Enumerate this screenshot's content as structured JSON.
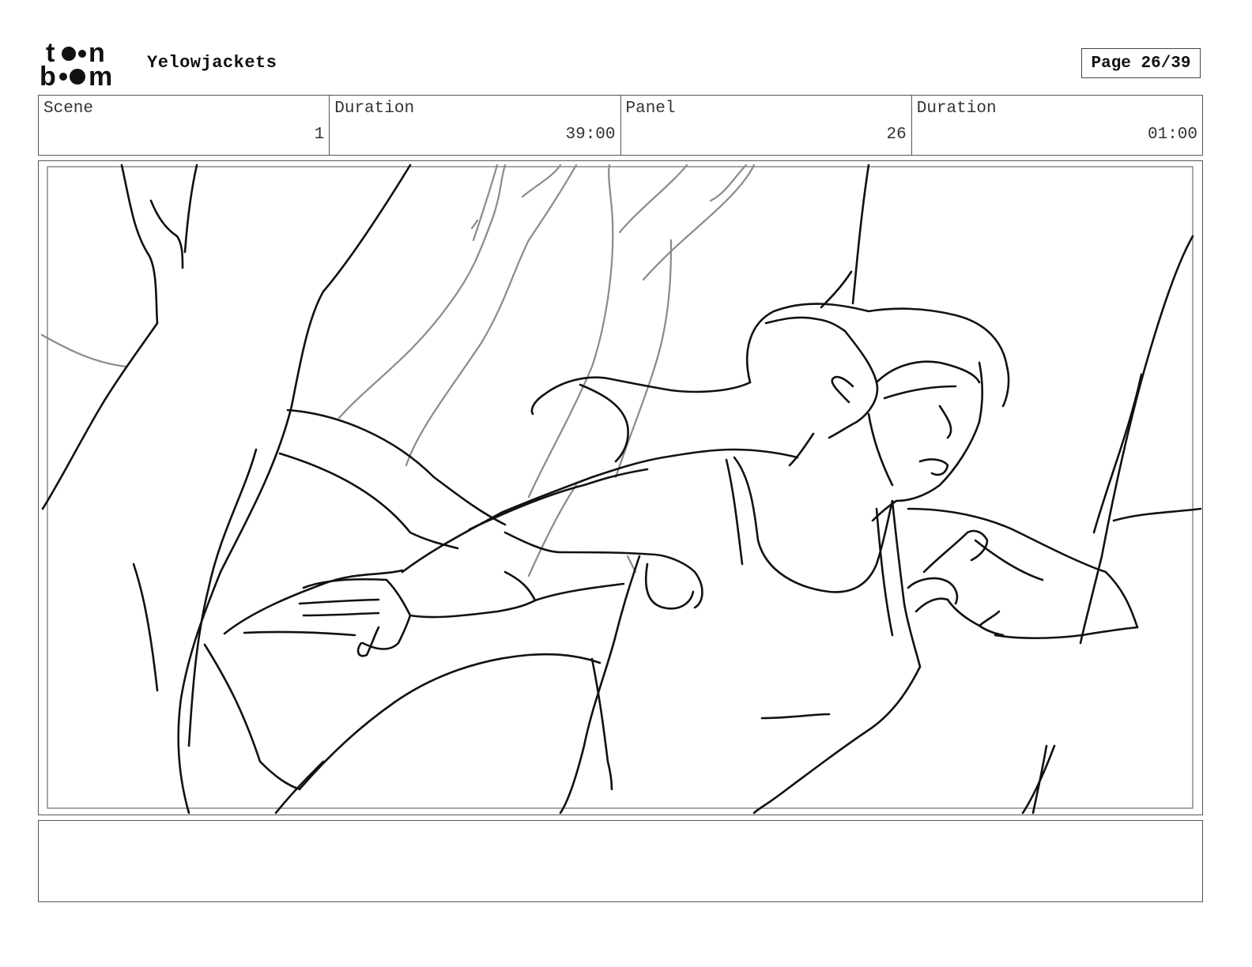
{
  "header": {
    "brand_logo_text": "toon boom",
    "project_title": "Yelowjackets",
    "page_indicator": "Page 26/39"
  },
  "info_row": {
    "scene": {
      "label": "Scene",
      "value": "1"
    },
    "scene_duration": {
      "label": "Duration",
      "value": "39:00"
    },
    "panel": {
      "label": "Panel",
      "value": "26"
    },
    "panel_duration": {
      "label": "Duration",
      "value": "01:00"
    }
  },
  "notes": {
    "text": ""
  }
}
